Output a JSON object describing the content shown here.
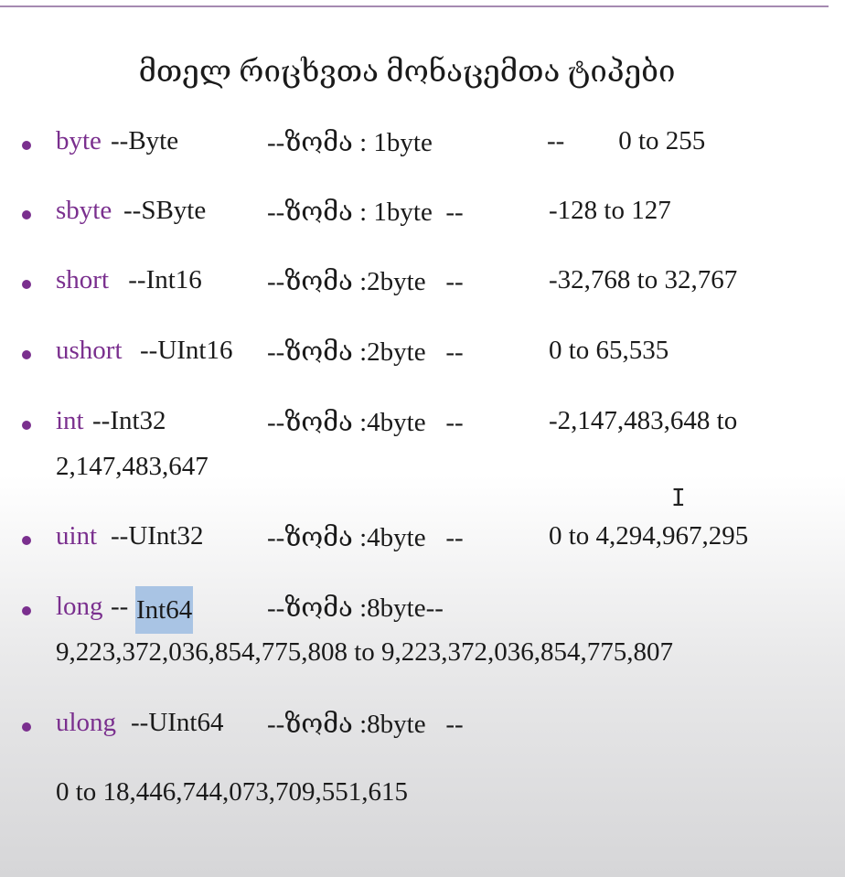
{
  "title": "მთელ რიცხვთა მონაცემთა ტიპები",
  "items": [
    {
      "keyword": "byte",
      "tail": " --Byte",
      "size": "--ზომა :    1byte",
      "dash": "--",
      "range": "     0 to 255"
    },
    {
      "keyword": "sbyte",
      "tail": "--SByte",
      "size": "--ზომა : 1byte  --",
      "dash": "",
      "range": "-128 to 127"
    },
    {
      "keyword": "short",
      "tail": " --Int16",
      "size": "--ზომა :2byte   --",
      "dash": "",
      "range": "-32,768 to 32,767"
    },
    {
      "keyword": "ushort",
      "tail": "--UInt16",
      "size": "--ზომა :2byte   --",
      "dash": "",
      "range": "0 to 65,535"
    },
    {
      "keyword": "int",
      "tail": "--Int32",
      "size": "--ზომა :4byte   --",
      "dash": "",
      "range": "-2,147,483,648 to",
      "range_cont": "2,147,483,647"
    },
    {
      "keyword": "uint",
      "tail": "--UInt32",
      "size": "--ზომა :4byte   --",
      "dash": "",
      "range": "0 to 4,294,967,295"
    },
    {
      "keyword": "long",
      "tail_dash": "--",
      "tail_hl": "Int64",
      "size": "--ზომა :8byte--",
      "dash": "",
      "range": "",
      "range_cont": "9,223,372,036,854,775,808 to 9,223,372,036,854,775,807"
    },
    {
      "keyword": "ulong",
      "tail": "--UInt64",
      "size": "--ზომა :8byte   --",
      "dash": "",
      "range": "",
      "range_cont": "0 to 18,446,744,073,709,551,615"
    }
  ],
  "colors": {
    "keyword": "#7a2f8e",
    "bullet": "#7a2f8e",
    "rule": "#a58ab1",
    "highlight": "#a9c4e4"
  },
  "cursor_icon": "text-cursor-icon"
}
